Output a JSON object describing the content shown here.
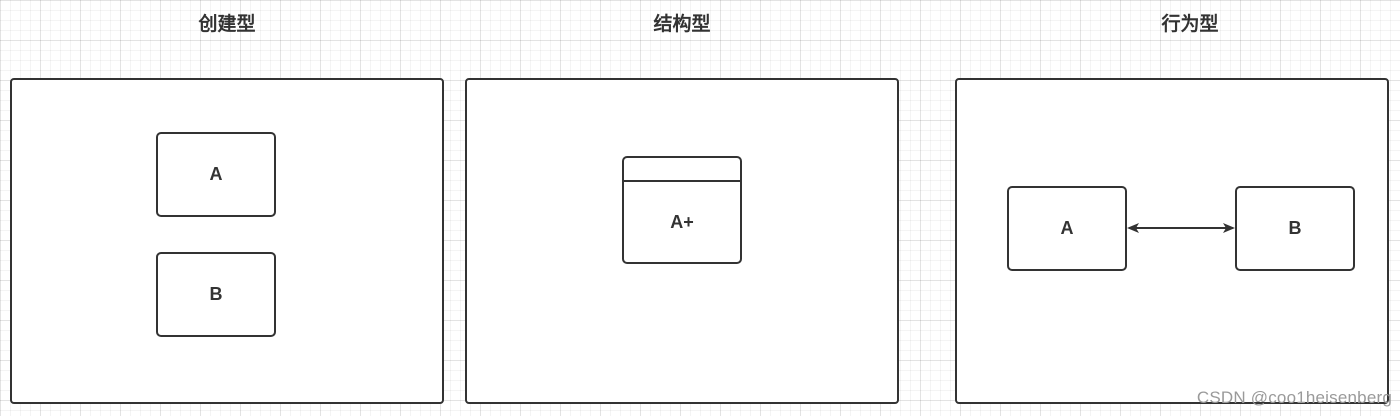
{
  "titles": {
    "creational": "创建型",
    "structural": "结构型",
    "behavioral": "行为型"
  },
  "creational_panel": {
    "node_a": "A",
    "node_b": "B"
  },
  "structural_panel": {
    "node_a_plus": "A+"
  },
  "behavioral_panel": {
    "node_a": "A",
    "node_b": "B"
  },
  "watermark": "CSDN @coo1heisenberg",
  "colors": {
    "stroke": "#333333",
    "watermark": "#9a9a9a",
    "background": "#ffffff"
  }
}
